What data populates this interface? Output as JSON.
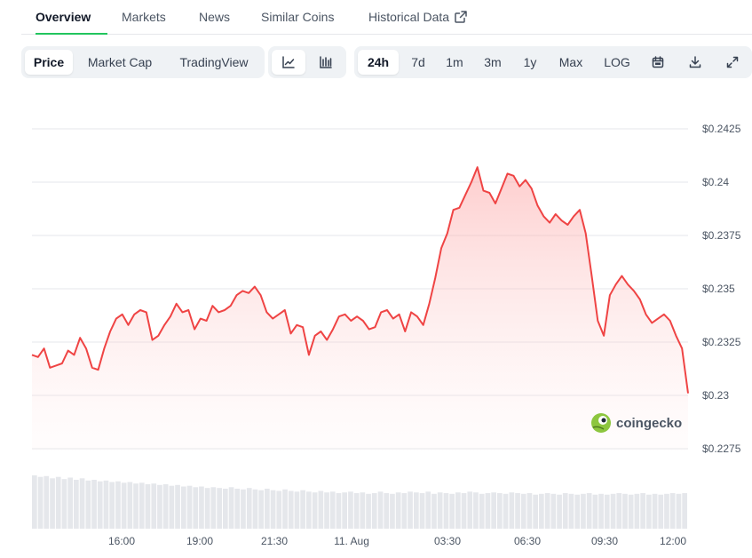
{
  "tabs": [
    {
      "label": "Overview",
      "active": true
    },
    {
      "label": "Markets"
    },
    {
      "label": "News"
    },
    {
      "label": "Similar Coins"
    },
    {
      "label": "Historical Data",
      "external": true
    }
  ],
  "toolbar": {
    "view_buttons": [
      {
        "label": "Price",
        "active": true
      },
      {
        "label": "Market Cap"
      },
      {
        "label": "TradingView"
      }
    ],
    "chart_type_buttons": [
      {
        "icon": "line-chart-icon",
        "active": true
      },
      {
        "icon": "candlestick-chart-icon"
      }
    ],
    "range_buttons": [
      {
        "label": "24h",
        "active": true
      },
      {
        "label": "7d"
      },
      {
        "label": "1m"
      },
      {
        "label": "3m"
      },
      {
        "label": "1y"
      },
      {
        "label": "Max"
      },
      {
        "label": "LOG"
      }
    ],
    "action_icons": [
      "calendar-icon",
      "download-icon",
      "expand-icon"
    ]
  },
  "watermark": "coingecko",
  "colors": {
    "line": "#ef4444",
    "fill": "#fecaca",
    "accent_tab": "#22c55e",
    "volume": "#e5e7eb"
  },
  "chart_data": {
    "type": "area",
    "y_ticks": [
      "$0.2425",
      "$0.24",
      "$0.2375",
      "$0.235",
      "$0.2325",
      "$0.23",
      "$0.2275"
    ],
    "x_ticks": [
      "16:00",
      "19:00",
      "21:30",
      "11. Aug",
      "03:30",
      "06:30",
      "09:30",
      "12:00"
    ],
    "ylim": [
      0.2275,
      0.2425
    ],
    "grid": true,
    "series": [
      {
        "values": [
          0.2319,
          0.2318,
          0.2322,
          0.2313,
          0.2314,
          0.2315,
          0.2321,
          0.2319,
          0.2327,
          0.2322,
          0.2313,
          0.2312,
          0.2322,
          0.233,
          0.2336,
          0.2338,
          0.2333,
          0.2338,
          0.234,
          0.2339,
          0.2326,
          0.2328,
          0.2333,
          0.2337,
          0.2343,
          0.2339,
          0.234,
          0.2331,
          0.2336,
          0.2335,
          0.2342,
          0.2339,
          0.234,
          0.2342,
          0.2347,
          0.2349,
          0.2348,
          0.2351,
          0.2347,
          0.2339,
          0.2336,
          0.2338,
          0.234,
          0.2329,
          0.2333,
          0.2332,
          0.2319,
          0.2328,
          0.233,
          0.2326,
          0.2331,
          0.2337,
          0.2338,
          0.2335,
          0.2337,
          0.2335,
          0.2331,
          0.2332,
          0.2339,
          0.234,
          0.2336,
          0.2338,
          0.233,
          0.2339,
          0.2337,
          0.2333,
          0.2343,
          0.2355,
          0.2369,
          0.2376,
          0.2387,
          0.2388,
          0.2394,
          0.24,
          0.2407,
          0.2396,
          0.2395,
          0.239,
          0.2397,
          0.2404,
          0.2403,
          0.2398,
          0.2401,
          0.2397,
          0.2389,
          0.2384,
          0.2381,
          0.2385,
          0.2382,
          0.238,
          0.2384,
          0.2387,
          0.2376,
          0.2356,
          0.2335,
          0.2328,
          0.2347,
          0.2352,
          0.2356,
          0.2352,
          0.2349,
          0.2345,
          0.2338,
          0.2334,
          0.2336,
          0.2338,
          0.2335,
          0.2328,
          0.2322,
          0.2301
        ]
      }
    ],
    "volume": [
      72,
      70,
      71,
      68,
      70,
      67,
      69,
      66,
      68,
      65,
      66,
      64,
      65,
      63,
      64,
      62,
      63,
      61,
      62,
      60,
      61,
      59,
      60,
      58,
      59,
      57,
      58,
      56,
      57,
      55,
      56,
      55,
      54,
      56,
      54,
      53,
      55,
      53,
      52,
      54,
      52,
      51,
      53,
      51,
      50,
      52,
      50,
      49,
      51,
      49,
      50,
      48,
      49,
      50,
      48,
      49,
      47,
      48,
      50,
      48,
      47,
      49,
      48,
      50,
      49,
      48,
      50,
      47,
      49,
      48,
      47,
      49,
      48,
      50,
      49,
      47,
      48,
      49,
      48,
      47,
      49,
      48,
      47,
      48,
      46,
      47,
      48,
      47,
      46,
      48,
      47,
      46,
      47,
      48,
      46,
      47,
      46,
      47,
      48,
      47,
      46,
      47,
      48,
      46,
      47,
      46,
      47,
      48,
      47,
      48
    ]
  }
}
